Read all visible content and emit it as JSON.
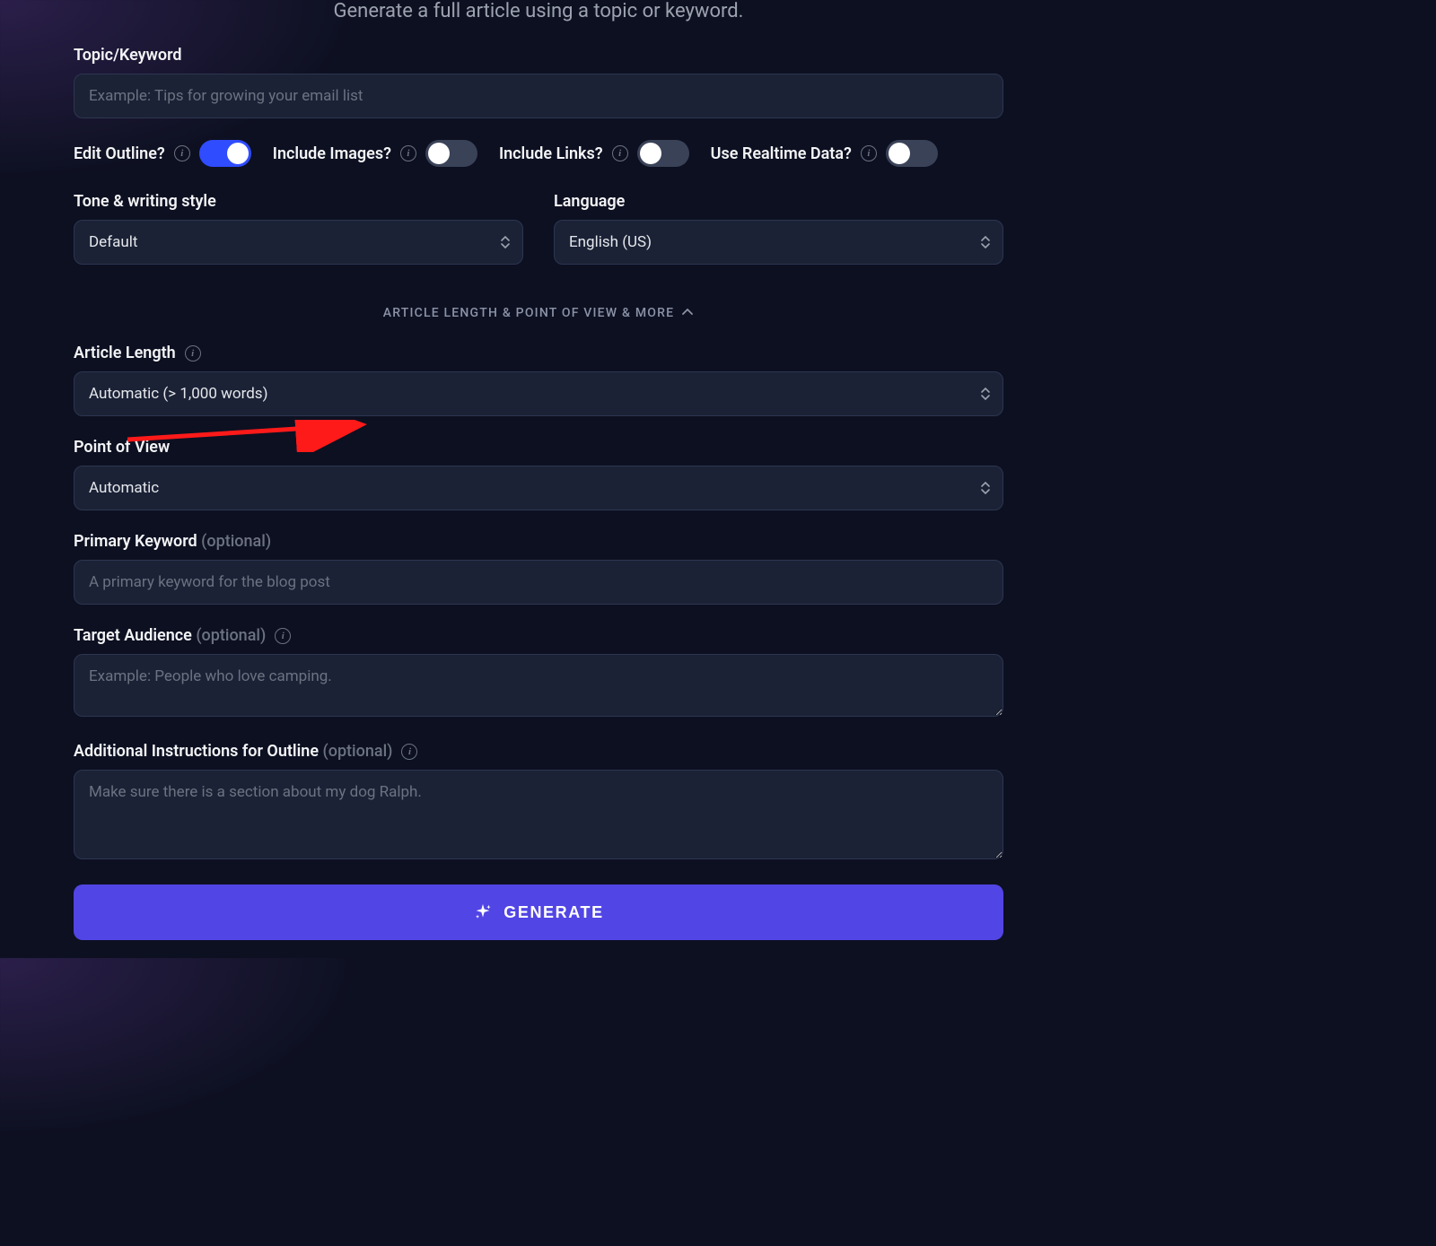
{
  "subtitle": "Generate a full article using a topic or keyword.",
  "topic": {
    "label": "Topic/Keyword",
    "placeholder": "Example: Tips for growing your email list"
  },
  "toggles": {
    "edit_outline": {
      "label": "Edit Outline?",
      "on": true
    },
    "include_images": {
      "label": "Include Images?",
      "on": false
    },
    "include_links": {
      "label": "Include Links?",
      "on": false
    },
    "realtime": {
      "label": "Use Realtime Data?",
      "on": false
    }
  },
  "tone": {
    "label": "Tone & writing style",
    "value": "Default"
  },
  "language": {
    "label": "Language",
    "value": "English (US)"
  },
  "expander_label": "ARTICLE LENGTH & POINT OF VIEW & MORE",
  "article_length": {
    "label": "Article Length",
    "value": "Automatic (> 1,000 words)"
  },
  "pov": {
    "label": "Point of View",
    "value": "Automatic"
  },
  "primary_keyword": {
    "label": "Primary Keyword",
    "optional": "(optional)",
    "placeholder": "A primary keyword for the blog post"
  },
  "target_audience": {
    "label": "Target Audience",
    "optional": "(optional)",
    "placeholder": "Example: People who love camping."
  },
  "instructions": {
    "label": "Additional Instructions for Outline",
    "optional": "(optional)",
    "placeholder": "Make sure there is a section about my dog Ralph."
  },
  "generate_label": "GENERATE"
}
